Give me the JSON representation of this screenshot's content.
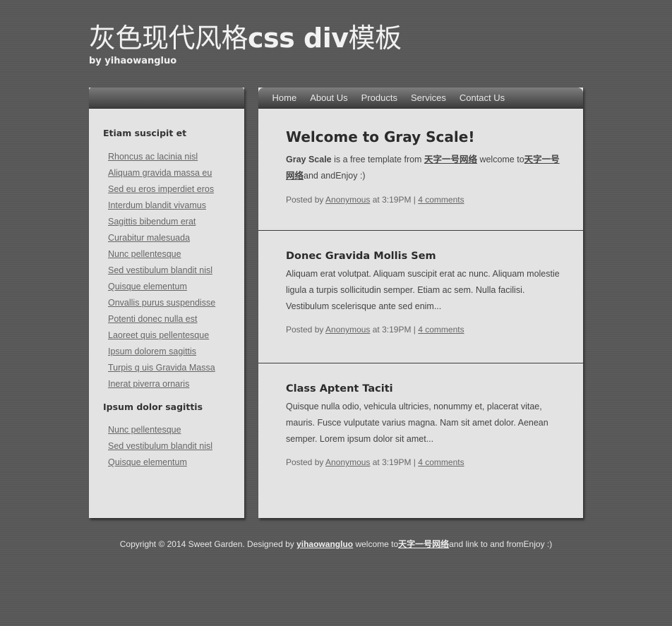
{
  "header": {
    "title_cn": "灰色现代风格",
    "title_en": "css div",
    "title_cn2": "模板",
    "byline": "by yihaowangluo"
  },
  "nav": {
    "items": [
      "Home",
      "About Us",
      "Products",
      "Services",
      "Contact Us"
    ]
  },
  "sidebar": {
    "section1": {
      "heading": "Etiam suscipit et",
      "links": [
        "Rhoncus ac lacinia nisl",
        "Aliquam gravida massa eu",
        "Sed eu eros imperdiet eros",
        "Interdum blandit vivamus",
        "Sagittis bibendum erat",
        "Curabitur malesuada",
        "Nunc pellentesque",
        "Sed vestibulum blandit nisl",
        "Quisque elementum",
        "Onvallis purus suspendisse",
        "Potenti donec nulla est",
        "Laoreet quis pellentesque",
        "Ipsum dolorem sagittis",
        "Turpis q uis Gravida Massa",
        "Inerat piverra ornaris"
      ]
    },
    "section2": {
      "heading": "Ipsum dolor sagittis",
      "links": [
        "Nunc pellentesque",
        "Sed vestibulum blandit nisl",
        "Quisque elementum"
      ]
    }
  },
  "posts": [
    {
      "title": "Welcome to Gray Scale!",
      "body_strong": "Gray Scale",
      "body_text1": " is a free template from ",
      "body_link1": "天字一号网络",
      "body_text2": " welcome to",
      "body_link2": "天字一号网络",
      "body_text3": "and andEnjoy :)",
      "meta_prefix": "Posted by ",
      "meta_author": "Anonymous",
      "meta_time": " at 3:19PM | ",
      "meta_comments": "4 comments"
    },
    {
      "title": "Donec Gravida Mollis Sem",
      "body": "Aliquam erat volutpat. Aliquam suscipit erat ac nunc. Aliquam molestie ligula a turpis sollicitudin semper. Etiam ac sem. Nulla facilisi. Vestibulum scelerisque ante sed enim...",
      "meta_prefix": "Posted by ",
      "meta_author": "Anonymous",
      "meta_time": " at 3:19PM | ",
      "meta_comments": "4 comments"
    },
    {
      "title": "Class Aptent Taciti",
      "body": "Quisque nulla odio, vehicula ultricies, nonummy et, placerat vitae, mauris. Fusce vulputate varius magna. Nam sit amet dolor. Aenean semper. Lorem ipsum dolor sit amet...",
      "meta_prefix": "Posted by ",
      "meta_author": "Anonymous",
      "meta_time": " at 3:19PM | ",
      "meta_comments": "4 comments"
    }
  ],
  "footer": {
    "text1": "Copyright © 2014 Sweet Garden. Designed by ",
    "link1": "yihaowangluo",
    "text2": " welcome to",
    "link2": "天字一号网络",
    "text3": "and link to and fromEnjoy :)"
  }
}
